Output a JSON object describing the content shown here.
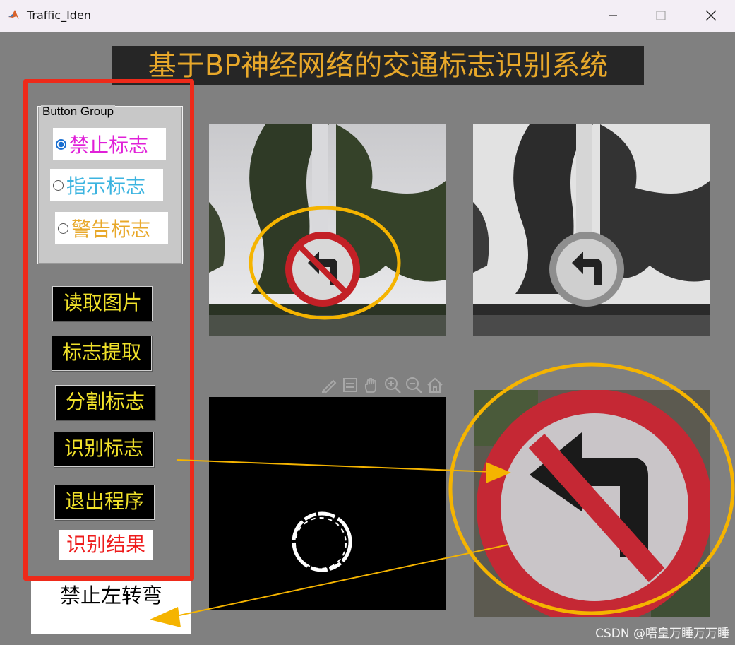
{
  "window": {
    "title": "Traffic_Iden",
    "minimize_icon": "minimize-icon",
    "maximize_icon": "maximize-icon",
    "close_icon": "close-icon"
  },
  "header": {
    "title": "基于BP神经网络的交通标志识别系统"
  },
  "button_group": {
    "legend": "Button Group",
    "options": [
      {
        "label": "禁止标志",
        "selected": true,
        "color": "#e020d8"
      },
      {
        "label": "指示标志",
        "selected": false,
        "color": "#3cb4e0"
      },
      {
        "label": "警告标志",
        "selected": false,
        "color": "#e8a82a"
      }
    ]
  },
  "buttons": {
    "read_image": "读取图片",
    "extract_sign": "标志提取",
    "segment_sign": "分割标志",
    "recognize_sign": "识别标志",
    "exit_program": "退出程序"
  },
  "result": {
    "label": "识别结果",
    "value": "禁止左转弯"
  },
  "axes_toolbar": [
    "brush-icon",
    "data-tips-icon",
    "pan-hand-icon",
    "zoom-in-icon",
    "zoom-out-icon",
    "home-icon"
  ],
  "colors": {
    "title_text": "#e8a82a",
    "button_text": "#f0e12a",
    "highlight_frame": "#ee2a1a",
    "annotation": "#f5b400",
    "result_label": "#ee1c1c"
  },
  "watermark": "CSDN @唔皇万睡万万睡"
}
